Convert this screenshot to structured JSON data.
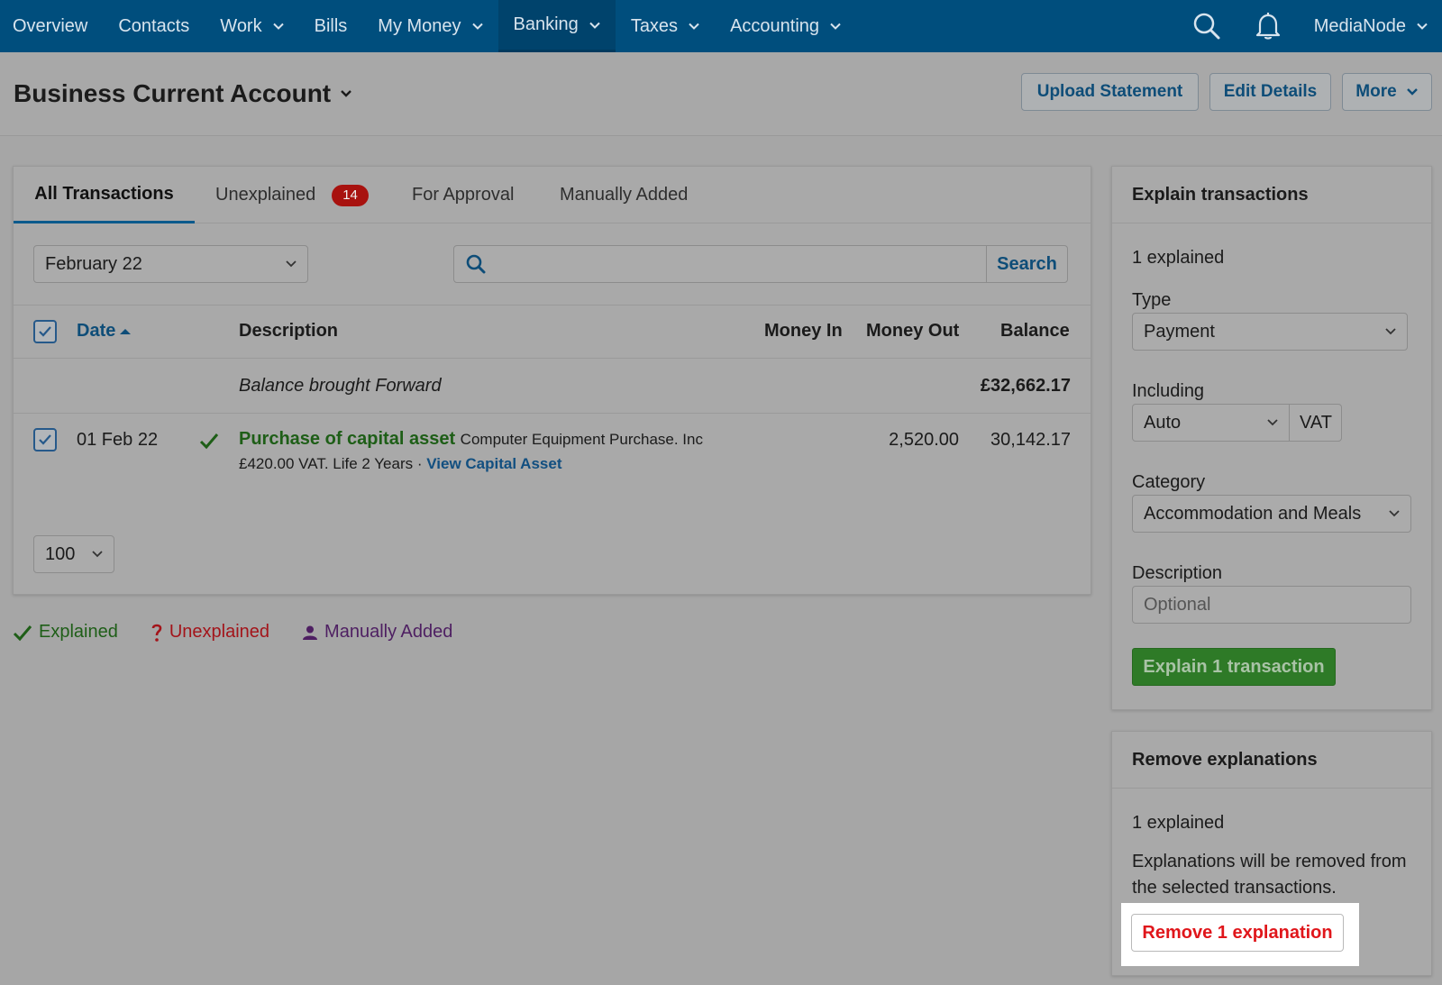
{
  "nav": {
    "items": [
      {
        "label": "Overview",
        "has_chevron": false
      },
      {
        "label": "Contacts",
        "has_chevron": false
      },
      {
        "label": "Work",
        "has_chevron": true
      },
      {
        "label": "Bills",
        "has_chevron": false
      },
      {
        "label": "My Money",
        "has_chevron": true
      },
      {
        "label": "Banking",
        "has_chevron": true,
        "active": true
      },
      {
        "label": "Taxes",
        "has_chevron": true
      },
      {
        "label": "Accounting",
        "has_chevron": true
      }
    ],
    "user_label": "MediaNode",
    "icons": [
      "search-icon",
      "bell-icon"
    ]
  },
  "header": {
    "title": "Business Current Account",
    "buttons": {
      "upload": "Upload Statement",
      "edit": "Edit Details",
      "more": "More"
    }
  },
  "transactions": {
    "tabs": {
      "all": "All Transactions",
      "unexplained": "Unexplained",
      "unexplained_count": "14",
      "approval": "For Approval",
      "manual": "Manually Added"
    },
    "month_filter": "February 22",
    "search": {
      "placeholder": "",
      "button": "Search"
    },
    "columns": {
      "date": "Date",
      "description": "Description",
      "money_in": "Money In",
      "money_out": "Money Out",
      "balance": "Balance"
    },
    "balance_forward": {
      "label": "Balance brought Forward",
      "amount": "£32,662.17"
    },
    "rows": [
      {
        "checked": true,
        "date": "01 Feb 22",
        "status": "explained",
        "title": "Purchase of capital asset",
        "contact": "Computer Equipment Purchase. Inc",
        "details": "£420.00 VAT. Life 2 Years ·",
        "link": "View Capital Asset",
        "money_in": "",
        "money_out": "2,520.00",
        "balance": "30,142.17"
      }
    ],
    "per_page": "100"
  },
  "legend": {
    "explained": "Explained",
    "unexplained": "Unexplained",
    "manual": "Manually Added",
    "colors": {
      "explained": "#1e5e17",
      "unexplained": "#a3141a",
      "manual": "#4e1f62"
    }
  },
  "explain_panel": {
    "title": "Explain transactions",
    "count_text": "1 explained",
    "type_label": "Type",
    "type_value": "Payment",
    "including_label": "Including",
    "including_value": "Auto",
    "vat_label": "VAT",
    "category_label": "Category",
    "category_value": "Accommodation and Meals",
    "description_label": "Description",
    "description_placeholder": "Optional",
    "button": "Explain 1 transaction"
  },
  "remove_panel": {
    "title": "Remove explanations",
    "count_text": "1 explained",
    "info_line1": "Explanations will be removed from",
    "info_line2": "the selected transactions.",
    "button": "Remove 1 explanation"
  },
  "colors": {
    "nav_bg": "#004e7d",
    "accent_link": "#0e4d78",
    "explained_green": "#1e5e17",
    "danger_red": "#e0161b",
    "badge_red": "#a8120f"
  }
}
